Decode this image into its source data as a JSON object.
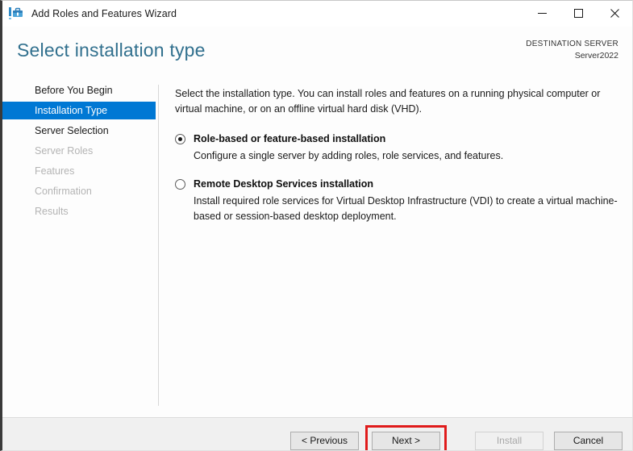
{
  "window": {
    "title": "Add Roles and Features Wizard",
    "icon": "server-manager-toolbox-icon",
    "controls": {
      "minimize": "minimize-icon",
      "maximize": "maximize-icon",
      "close": "close-icon"
    }
  },
  "header": {
    "page_title": "Select installation type",
    "destination_label": "DESTINATION SERVER",
    "destination_server": "Server2022",
    "accent_color": "#31708E"
  },
  "sidebar": {
    "selected_color": "#0078d4",
    "items": [
      {
        "label": "Before You Begin",
        "state": "enabled"
      },
      {
        "label": "Installation Type",
        "state": "selected"
      },
      {
        "label": "Server Selection",
        "state": "enabled"
      },
      {
        "label": "Server Roles",
        "state": "disabled"
      },
      {
        "label": "Features",
        "state": "disabled"
      },
      {
        "label": "Confirmation",
        "state": "disabled"
      },
      {
        "label": "Results",
        "state": "disabled"
      }
    ]
  },
  "main": {
    "intro": "Select the installation type. You can install roles and features on a running physical computer or virtual machine, or on an offline virtual hard disk (VHD).",
    "options": [
      {
        "label": "Role-based or feature-based installation",
        "description": "Configure a single server by adding roles, role services, and features.",
        "selected": true
      },
      {
        "label": "Remote Desktop Services installation",
        "description": "Install required role services for Virtual Desktop Infrastructure (VDI) to create a virtual machine-based or session-based desktop deployment.",
        "selected": false
      }
    ]
  },
  "footer": {
    "previous_label": "< Previous",
    "next_label": "Next >",
    "install_label": "Install",
    "cancel_label": "Cancel",
    "install_enabled": false,
    "highlight_color": "#e01b1b",
    "highlighted_button": "Next >"
  }
}
